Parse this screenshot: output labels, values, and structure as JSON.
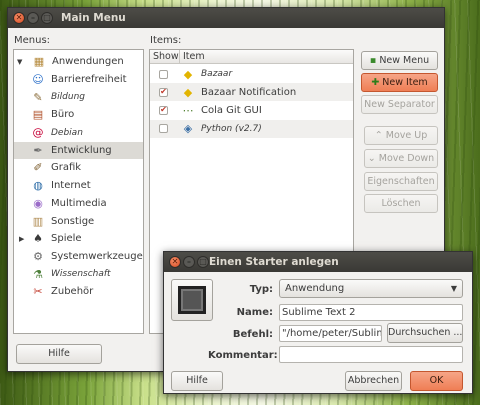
{
  "main_window": {
    "title": "Main Menu",
    "menus_label": "Menus:",
    "items_label": "Items:",
    "help": "Hilfe"
  },
  "menus": [
    {
      "label": "Anwendungen",
      "icon": "applications-icon",
      "italic": false,
      "expander": "▼"
    },
    {
      "label": "Barrierefreiheit",
      "icon": "accessibility-icon",
      "italic": false
    },
    {
      "label": "Bildung",
      "icon": "education-icon",
      "italic": true
    },
    {
      "label": "Büro",
      "icon": "office-icon",
      "italic": false
    },
    {
      "label": "Debian",
      "icon": "debian-icon",
      "italic": true
    },
    {
      "label": "Entwicklung",
      "icon": "development-icon",
      "italic": false,
      "selected": true
    },
    {
      "label": "Grafik",
      "icon": "graphics-icon",
      "italic": false
    },
    {
      "label": "Internet",
      "icon": "internet-icon",
      "italic": false
    },
    {
      "label": "Multimedia",
      "icon": "multimedia-icon",
      "italic": false
    },
    {
      "label": "Sonstige",
      "icon": "other-icon",
      "italic": false
    },
    {
      "label": "Spiele",
      "icon": "games-icon",
      "italic": false,
      "expander": "▶"
    },
    {
      "label": "Systemwerkzeuge",
      "icon": "system-tools-icon",
      "italic": false
    },
    {
      "label": "Wissenschaft",
      "icon": "science-icon",
      "italic": true
    },
    {
      "label": "Zubehör",
      "icon": "accessories-icon",
      "italic": false
    }
  ],
  "items_header": {
    "show": "Show",
    "item": "Item"
  },
  "items": [
    {
      "label": "Bazaar",
      "checked": false,
      "italic": true,
      "icon": "bazaar-icon"
    },
    {
      "label": "Bazaar Notification",
      "checked": true,
      "italic": false,
      "icon": "bazaar-icon"
    },
    {
      "label": "Cola Git GUI",
      "checked": true,
      "italic": false,
      "icon": "git-icon"
    },
    {
      "label": "Python (v2.7)",
      "checked": false,
      "italic": true,
      "icon": "python-icon"
    }
  ],
  "side_buttons": {
    "new_menu": "New Menu",
    "new_item": "New Item",
    "new_separator": "New Separator",
    "move_up": "Move Up",
    "move_down": "Move Down",
    "properties": "Eigenschaften",
    "delete": "Löschen"
  },
  "dialog": {
    "title": "Einen Starter anlegen",
    "type_label": "Typ:",
    "type_value": "Anwendung",
    "name_label": "Name:",
    "name_value": "Sublime Text 2",
    "command_label": "Befehl:",
    "command_value": "\"/home/peter/Sublime",
    "browse": "Durchsuchen ...",
    "comment_label": "Kommentar:",
    "comment_value": "",
    "help": "Hilfe",
    "cancel": "Abbrechen",
    "ok": "OK"
  },
  "colors": {
    "accent": "#ef7e55",
    "titlebar": "#3c3b37"
  }
}
